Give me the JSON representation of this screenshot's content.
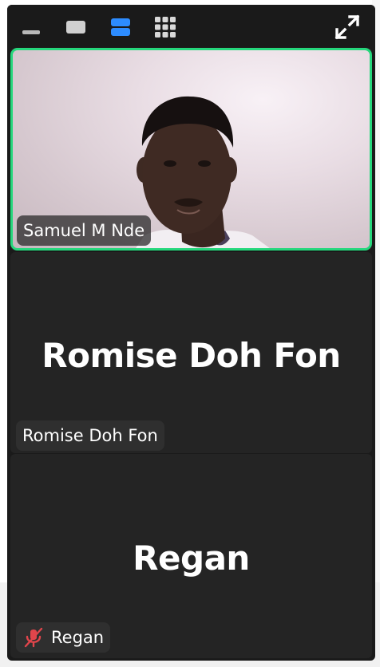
{
  "toolbar": {
    "buttons": [
      {
        "name": "minimize-view-icon"
      },
      {
        "name": "speaker-view-icon"
      },
      {
        "name": "strip-view-icon",
        "active": true
      },
      {
        "name": "gallery-view-icon"
      }
    ],
    "expand_icon": "expand-icon",
    "accent_color": "#2d8cff"
  },
  "participants": [
    {
      "name": "Samuel M Nde",
      "video_on": true,
      "speaking": true,
      "border_color": "#25d77c"
    },
    {
      "name": "Romise Doh Fon",
      "video_on": false,
      "display_name": "Romise Doh Fon"
    },
    {
      "name": "Regan",
      "video_on": false,
      "display_name": "Regan",
      "muted": true,
      "mute_icon": "microphone-muted-icon"
    }
  ]
}
